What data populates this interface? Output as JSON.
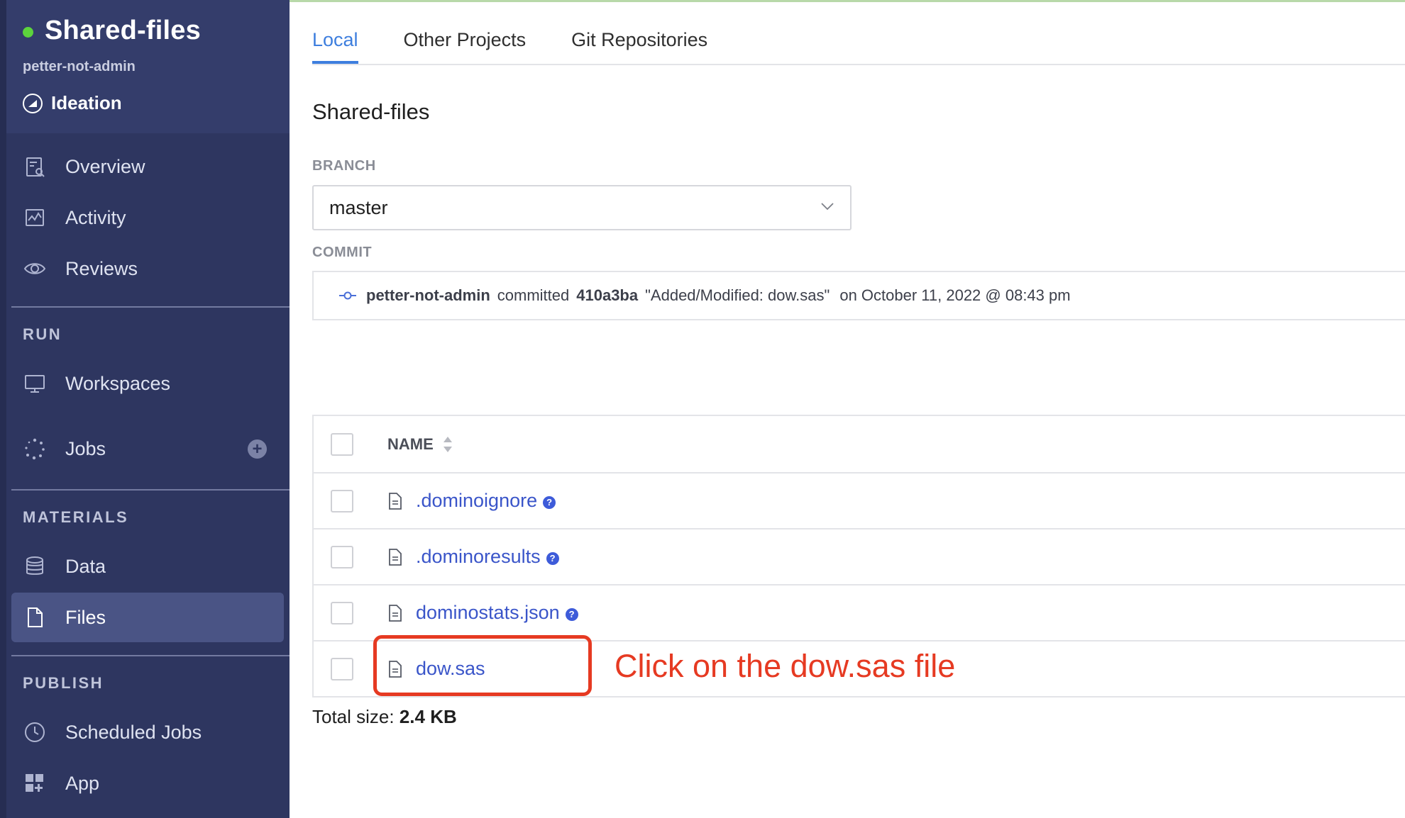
{
  "sidebar": {
    "project_name": "Shared-files",
    "owner": "petter-not-admin",
    "stage": "Ideation",
    "status_color": "#5cd43c",
    "nav_top": [
      {
        "label": "Overview",
        "icon": "overview-icon"
      },
      {
        "label": "Activity",
        "icon": "activity-icon"
      },
      {
        "label": "Reviews",
        "icon": "eye-icon"
      }
    ],
    "section_run": "RUN",
    "run_items": [
      {
        "label": "Workspaces",
        "icon": "monitor-icon"
      },
      {
        "label": "Jobs",
        "icon": "jobs-icon",
        "add_label": "+"
      }
    ],
    "section_materials": "MATERIALS",
    "materials_items": [
      {
        "label": "Data",
        "icon": "database-icon"
      },
      {
        "label": "Files",
        "icon": "file-icon",
        "active": true
      }
    ],
    "section_publish": "PUBLISH",
    "publish_items": [
      {
        "label": "Scheduled Jobs",
        "icon": "clock-icon"
      },
      {
        "label": "App",
        "icon": "app-icon"
      }
    ]
  },
  "main": {
    "tabs": [
      {
        "label": "Local",
        "active": true
      },
      {
        "label": "Other Projects"
      },
      {
        "label": "Git Repositories"
      }
    ],
    "title": "Shared-files",
    "branch_label": "BRANCH",
    "branch_value": "master",
    "commit_label": "COMMIT",
    "commit": {
      "author": "petter-not-admin",
      "verb": "committed",
      "hash": "410a3ba",
      "message": "\"Added/Modified: dow.sas\"",
      "date": "on October 11, 2022 @ 08:43 pm"
    },
    "table": {
      "header_name": "NAME",
      "files": [
        {
          "name": ".dominoignore",
          "help": "?"
        },
        {
          "name": ".dominoresults",
          "help": "?"
        },
        {
          "name": "dominostats.json",
          "help": "?"
        },
        {
          "name": "dow.sas"
        }
      ]
    },
    "total_size_label": "Total size:",
    "total_size_value": "2.4 KB",
    "annotation": "Click on the dow.sas file",
    "accent_color": "#3d7ede",
    "link_color": "#3a55c9",
    "annotation_color": "#e63a22"
  }
}
